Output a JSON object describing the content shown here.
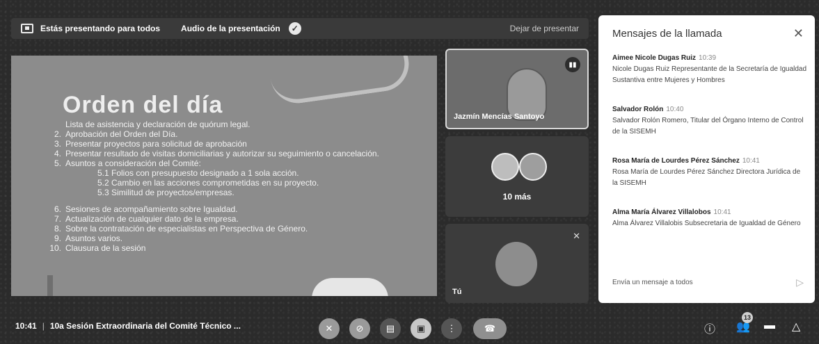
{
  "present_bar": {
    "presenting_label": "Estás presentando para todos",
    "audio_label": "Audio de la presentación",
    "stop_label": "Dejar de presentar"
  },
  "slide": {
    "title": "Orden del día",
    "items": [
      {
        "num": "",
        "text": "Lista de asistencia y declaración de quórum legal."
      },
      {
        "num": "2.",
        "text": "Aprobación del Orden del Día."
      },
      {
        "num": "3.",
        "text": "Presentar proyectos para solicitud de aprobación"
      },
      {
        "num": "4.",
        "text": "Presentar resultado de visitas domiciliarias y autorizar su seguimiento o cancelación."
      },
      {
        "num": "5.",
        "text": "Asuntos a consideración del Comité:"
      }
    ],
    "subitems": [
      "5.1 Folios con presupuesto designado a 1 sola acción.",
      "5.2 Cambio en las acciones comprometidas en su proyecto.",
      "5.3 Similitud de proyectos/empresas."
    ],
    "items2": [
      {
        "num": "6.",
        "text": "Sesiones de acompañamiento sobre Igualdad."
      },
      {
        "num": "7.",
        "text": "Actualización de cualquier dato de la empresa."
      },
      {
        "num": "8.",
        "text": "Sobre la contratación de especialistas en Perspectiva de Género."
      },
      {
        "num": "9.",
        "text": "Asuntos varios."
      },
      {
        "num": "10.",
        "text": "Clausura de la sesión"
      }
    ]
  },
  "tiles": {
    "presenter_name": "Jazmín Mencías Santoyo",
    "more_label": "10 más",
    "self_label": "Tú"
  },
  "chat": {
    "title": "Mensajes de la llamada",
    "messages": [
      {
        "sender": "Aimee Nicole Dugas Ruiz",
        "time": "10:39",
        "text": "Nicole Dugas Ruiz Representante de la Secretaría de Igualdad Sustantiva entre Mujeres y Hombres"
      },
      {
        "sender": "Salvador Rolón",
        "time": "10:40",
        "text": "Salvador Rolón Romero, Titular del Órgano Interno de Control de la SISEMH"
      },
      {
        "sender": "Rosa María de Lourdes Pérez Sánchez",
        "time": "10:41",
        "text": "Rosa María de Lourdes Pérez Sánchez Directora Jurídica de la SISEMH"
      },
      {
        "sender": "Alma María Álvarez Villalobos",
        "time": "10:41",
        "text": "Alma Álvarez Villalobis Subsecretaria de Igualdad de Género"
      }
    ],
    "input_placeholder": "Envía un mensaje a todos"
  },
  "bottom": {
    "time": "10:41",
    "meeting_title": "10a Sesión Extraordinaria del Comité Técnico ...",
    "participants_count": "13"
  }
}
